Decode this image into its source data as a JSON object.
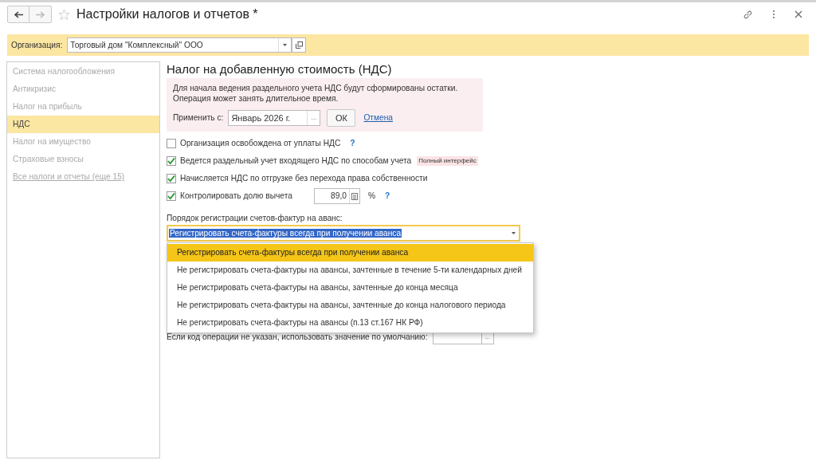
{
  "window": {
    "title": "Настройки налогов и отчетов *"
  },
  "organization": {
    "label": "Организация:",
    "value": "Торговый дом \"Комплексный\" ООО"
  },
  "sidebar": {
    "items": [
      {
        "label": "Система налогообложения",
        "selected": false,
        "kind": "item"
      },
      {
        "label": "Антикризис",
        "selected": false,
        "kind": "item"
      },
      {
        "label": "Налог на прибыль",
        "selected": false,
        "kind": "item"
      },
      {
        "label": "НДС",
        "selected": true,
        "kind": "item"
      },
      {
        "label": "Налог на имущество",
        "selected": false,
        "kind": "item"
      },
      {
        "label": "Страховые взносы",
        "selected": false,
        "kind": "item"
      },
      {
        "label": "Все налоги и отчеты (еще 15)",
        "kind": "link"
      }
    ]
  },
  "section": {
    "title": "Налог на добавленную стоимость (НДС)",
    "notice": {
      "lines": [
        "Для начала ведения раздельного учета НДС будут сформированы остатки.",
        "Операция может занять длительное время."
      ],
      "apply_label": "Применить с:",
      "apply_value": "Январь 2026 г.",
      "choose_button": "...",
      "ok_button": "ОК",
      "cancel_link": "Отмена"
    },
    "options": [
      {
        "label": "Организация освобождена от уплаты НДС",
        "checked": false,
        "help": "?"
      },
      {
        "label": "Ведется раздельный учет входящего НДС по способам учета",
        "checked": true,
        "badge": "Полный интерфейс"
      },
      {
        "label": "Начисляется НДС по отгрузке без перехода права собственности",
        "checked": true
      },
      {
        "label": "Контролировать долю вычета",
        "checked": true,
        "value": "89,0",
        "unit": "%",
        "help": "?"
      }
    ],
    "invoice_order": {
      "label": "Порядок регистрации счетов-фактур на аванс:",
      "value": "Регистрировать счета-фактуры всегда при получении аванса",
      "expanded": true,
      "options": [
        {
          "label": "Регистрировать счета-фактуры всегда при получении аванса",
          "selected": true
        },
        {
          "label": "Не регистрировать счета-фактуры на авансы, зачтенные в течение 5-ти календарных дней",
          "selected": false
        },
        {
          "label": "Не регистрировать счета-фактуры на авансы, зачтенные до конца месяца",
          "selected": false
        },
        {
          "label": "Не регистрировать счета-фактуры на авансы, зачтенные до конца налогового периода",
          "selected": false
        },
        {
          "label": "Не регистрировать счета-фактуры на авансы (п.13 ст.167 НК РФ)",
          "selected": false
        }
      ]
    },
    "default_code": {
      "label": "Если код операции не указан, использовать значение по умолчанию:",
      "choose_button": "..."
    }
  }
}
